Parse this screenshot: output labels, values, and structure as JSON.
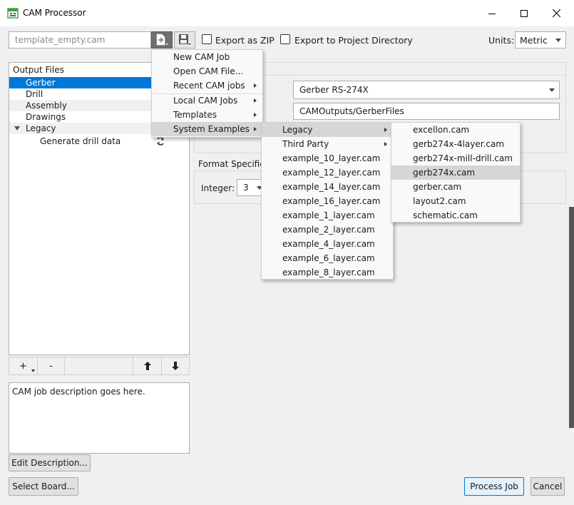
{
  "window": {
    "title": "CAM Processor",
    "minimize_glyph": "minimize-icon",
    "maximize_glyph": "maximize-icon",
    "close_glyph": "close-icon"
  },
  "toolbar": {
    "template_value": "template_empty.cam",
    "export_zip_label": "Export as ZIP",
    "export_project_label": "Export to Project Directory",
    "units_label": "Units:",
    "units_value": "Metric"
  },
  "output_files": {
    "header": "Output Files",
    "items": [
      {
        "label": "Gerber"
      },
      {
        "label": "Drill"
      },
      {
        "label": "Assembly"
      },
      {
        "label": "Drawings"
      },
      {
        "label": "Legacy"
      },
      {
        "label": "Generate drill data"
      }
    ],
    "tools": {
      "add": "+",
      "remove": "-"
    }
  },
  "description": {
    "text": "CAM job description goes here.",
    "edit_button": "Edit Description..."
  },
  "footer": {
    "select_board": "Select Board...",
    "process_job": "Process Job",
    "cancel": "Cancel"
  },
  "settings": {
    "format_value": "Gerber RS-274X",
    "output_path": "CAMOutputs/GerberFiles",
    "format_spec_label": "Format Specifier",
    "integer_label": "Integer:",
    "integer_value": "3"
  },
  "file_menu": {
    "items": [
      "New CAM Job",
      "Open CAM File...",
      "Recent CAM jobs",
      "Local CAM Jobs",
      "Templates",
      "System Examples"
    ]
  },
  "examples_menu": {
    "items": [
      "Legacy",
      "Third Party",
      "example_10_layer.cam",
      "example_12_layer.cam",
      "example_14_layer.cam",
      "example_16_layer.cam",
      "example_1_layer.cam",
      "example_2_layer.cam",
      "example_4_layer.cam",
      "example_6_layer.cam",
      "example_8_layer.cam"
    ]
  },
  "legacy_menu": {
    "items": [
      "excellon.cam",
      "gerb274x-4layer.cam",
      "gerb274x-mill-drill.cam",
      "gerb274x.cam",
      "gerber.cam",
      "layout2.cam",
      "schematic.cam"
    ]
  }
}
